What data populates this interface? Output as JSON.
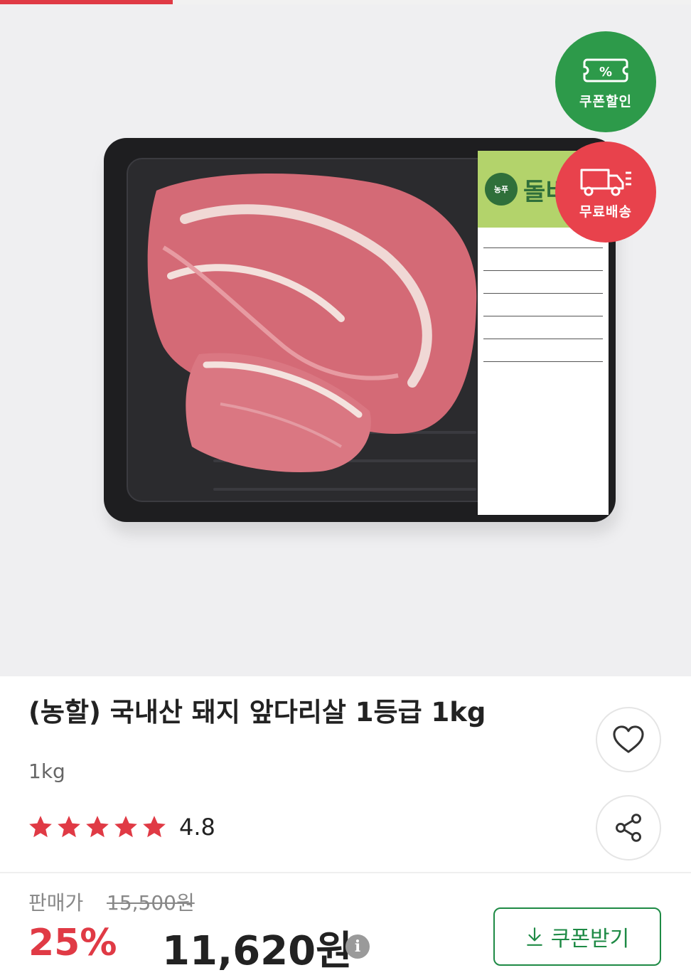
{
  "colors": {
    "accent_red": "#e03a45",
    "coupon_green": "#2d9a4a",
    "delivery_red": "#e8424c"
  },
  "progress": {
    "fraction": 0.25
  },
  "image": {
    "badges": {
      "coupon_label": "쿠폰할인",
      "coupon_icon_text": "%",
      "delivery_label": "무료배송"
    },
    "sticker": {
      "brand": "돌비",
      "logo": "농푸"
    }
  },
  "product": {
    "title": "(농할) 국내산 돼지 앞다리살 1등급 1kg",
    "weight": "1kg",
    "rating": "4.8",
    "star_count": 5
  },
  "price": {
    "label": "판매가",
    "original": "15,500원",
    "discount": "25%",
    "sale": "11,620원",
    "info_icon": "i"
  },
  "coupon_button": {
    "label": "쿠폰받기"
  },
  "icons": {
    "like": "heart-icon",
    "share": "share-icon",
    "download": "download-icon",
    "info": "info-icon",
    "star": "star-icon"
  }
}
